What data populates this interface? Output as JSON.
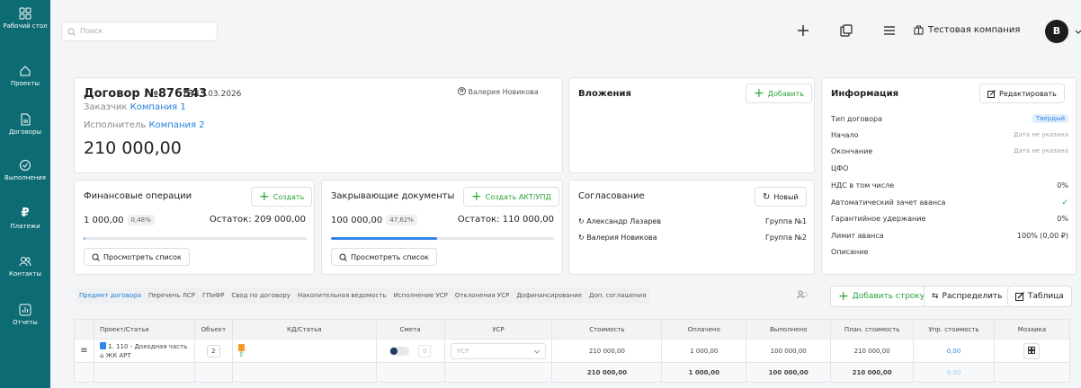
{
  "sidebar": {
    "items": [
      {
        "label": "Рабочий стол",
        "icon": "dashboard-icon"
      },
      {
        "label": "Проекты",
        "icon": "home-icon"
      },
      {
        "label": "Договоры",
        "icon": "document-icon"
      },
      {
        "label": "Выполнения",
        "icon": "check-circle-icon"
      },
      {
        "label": "Платежи",
        "icon": "ruble-icon"
      },
      {
        "label": "Контакты",
        "icon": "contacts-icon"
      },
      {
        "label": "Отчеты",
        "icon": "report-icon"
      }
    ]
  },
  "topbar": {
    "search_placeholder": "Поиск",
    "company": "Тестовая компания",
    "avatar_letter": "В"
  },
  "contract": {
    "title": "Договор №876543",
    "date": "13.03.2026",
    "customer_label": "Заказчик",
    "customer": "Компания 1",
    "executor_label": "Исполнитель",
    "executor": "Компания 2",
    "amount": "210 000,00",
    "manager": "Валерия Новикова"
  },
  "attachments": {
    "title": "Вложения",
    "add_label": "Добавить"
  },
  "info": {
    "title": "Информация",
    "edit_label": "Редактировать",
    "rows": [
      {
        "label": "Тип договора",
        "value": "Твердый"
      },
      {
        "label": "Начало",
        "value": "Дата не указана"
      },
      {
        "label": "Окончание",
        "value": "Дата не указана"
      },
      {
        "label": "ЦФО",
        "value": ""
      },
      {
        "label": "НДС в том числе",
        "value": "0%"
      },
      {
        "label": "Автоматический зачет аванса",
        "value": "✓"
      },
      {
        "label": "Гарантийное удержание",
        "value": "0%"
      },
      {
        "label": "Лимит аванса",
        "value": "100% (0,00 ₽)"
      },
      {
        "label": "Описание",
        "value": ""
      }
    ]
  },
  "finance": {
    "title": "Финансовые операции",
    "create_label": "Создать",
    "amount": "1 000,00",
    "percent": "0,48%",
    "remainder": "Остаток: 209 000,00",
    "progress": 0.0048,
    "view_list": "Просмотреть список"
  },
  "closing": {
    "title": "Закрывающие документы",
    "create_label": "Создать АКТ/УПД",
    "amount": "100 000,00",
    "percent": "47,62%",
    "remainder": "Остаток: 110 000,00",
    "progress": 0.4762,
    "view_list": "Просмотреть список"
  },
  "approval": {
    "title": "Согласование",
    "new_label": "Новый",
    "people": [
      {
        "name": "Александр Лазарев",
        "group": "Группа №1"
      },
      {
        "name": "Валерия Новикова",
        "group": "Группа №2"
      }
    ]
  },
  "tabs": [
    "Предмет договора",
    "Перечень ЛСР",
    "ГПиФР",
    "Свод по договору",
    "Накопительная ведомость",
    "Исполнение УСР",
    "Отклонения УСР",
    "Дофинансирование",
    "Доп. соглашения"
  ],
  "actions": {
    "add_row": "Добавить строку",
    "distribute": "Распределить",
    "table": "Таблица"
  },
  "table": {
    "headers": [
      "Проект/Статья",
      "Объект",
      "КД/Статья",
      "Смета",
      "УСР",
      "Стоимость",
      "Оплачено",
      "Выполнено",
      "План. стоимость",
      "Упр. стоимость",
      "Мозаика"
    ],
    "row": {
      "article": "1. 110 - Доходная часть",
      "project": "ЖК АРТ",
      "object": "2",
      "smeta_count": "0",
      "usr_placeholder": "УСР",
      "cost": "210 000,00",
      "paid": "1 000,00",
      "done": "100 000,00",
      "plan": "210 000,00",
      "mgmt": "0,00"
    },
    "totals": {
      "cost": "210 000,00",
      "paid": "1 000,00",
      "done": "100 000,00",
      "plan": "210 000,00",
      "mgmt": "0,00"
    }
  }
}
